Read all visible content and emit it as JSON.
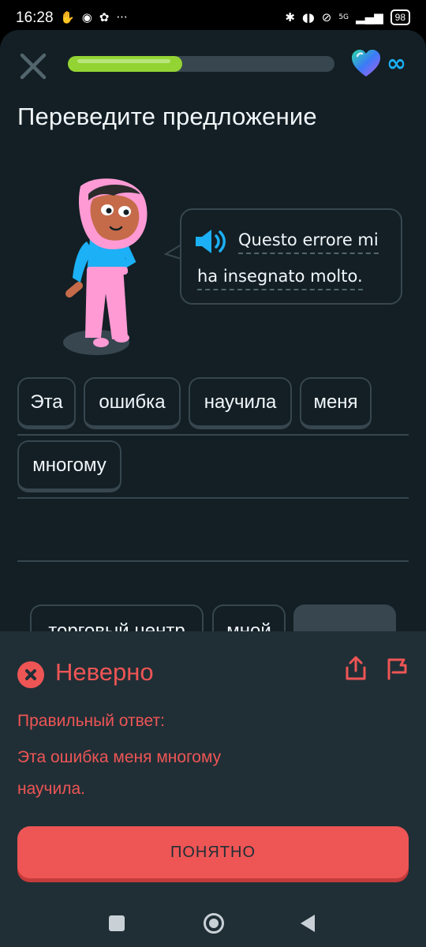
{
  "status_bar": {
    "time": "16:28",
    "network": "5G",
    "battery": "98"
  },
  "lesson": {
    "progress": 0.43,
    "title": "Переведите предложение",
    "prompt_line1": "Questo errore mi",
    "prompt_line2": "ha insegnato molto.",
    "answer_words": [
      "Эта",
      "ошибка",
      "научила",
      "меня",
      "многому"
    ],
    "bank_words": [
      "торговый центр",
      "мной"
    ],
    "lives": "∞"
  },
  "result": {
    "status": "Неверно",
    "correct_label": "Правильный ответ:",
    "correct_answer": "Эта ошибка меня многому научила.",
    "continue_label": "ПОНЯТНО"
  },
  "colors": {
    "background": "#131f24",
    "panel": "#202f36",
    "error": "#ee5555",
    "progress": "#93d333",
    "accent": "#1cb0f6"
  },
  "icons": [
    "close-icon",
    "heart-gem-icon",
    "infinity-icon",
    "speaker-icon",
    "error-x-icon",
    "share-icon",
    "flag-icon"
  ]
}
